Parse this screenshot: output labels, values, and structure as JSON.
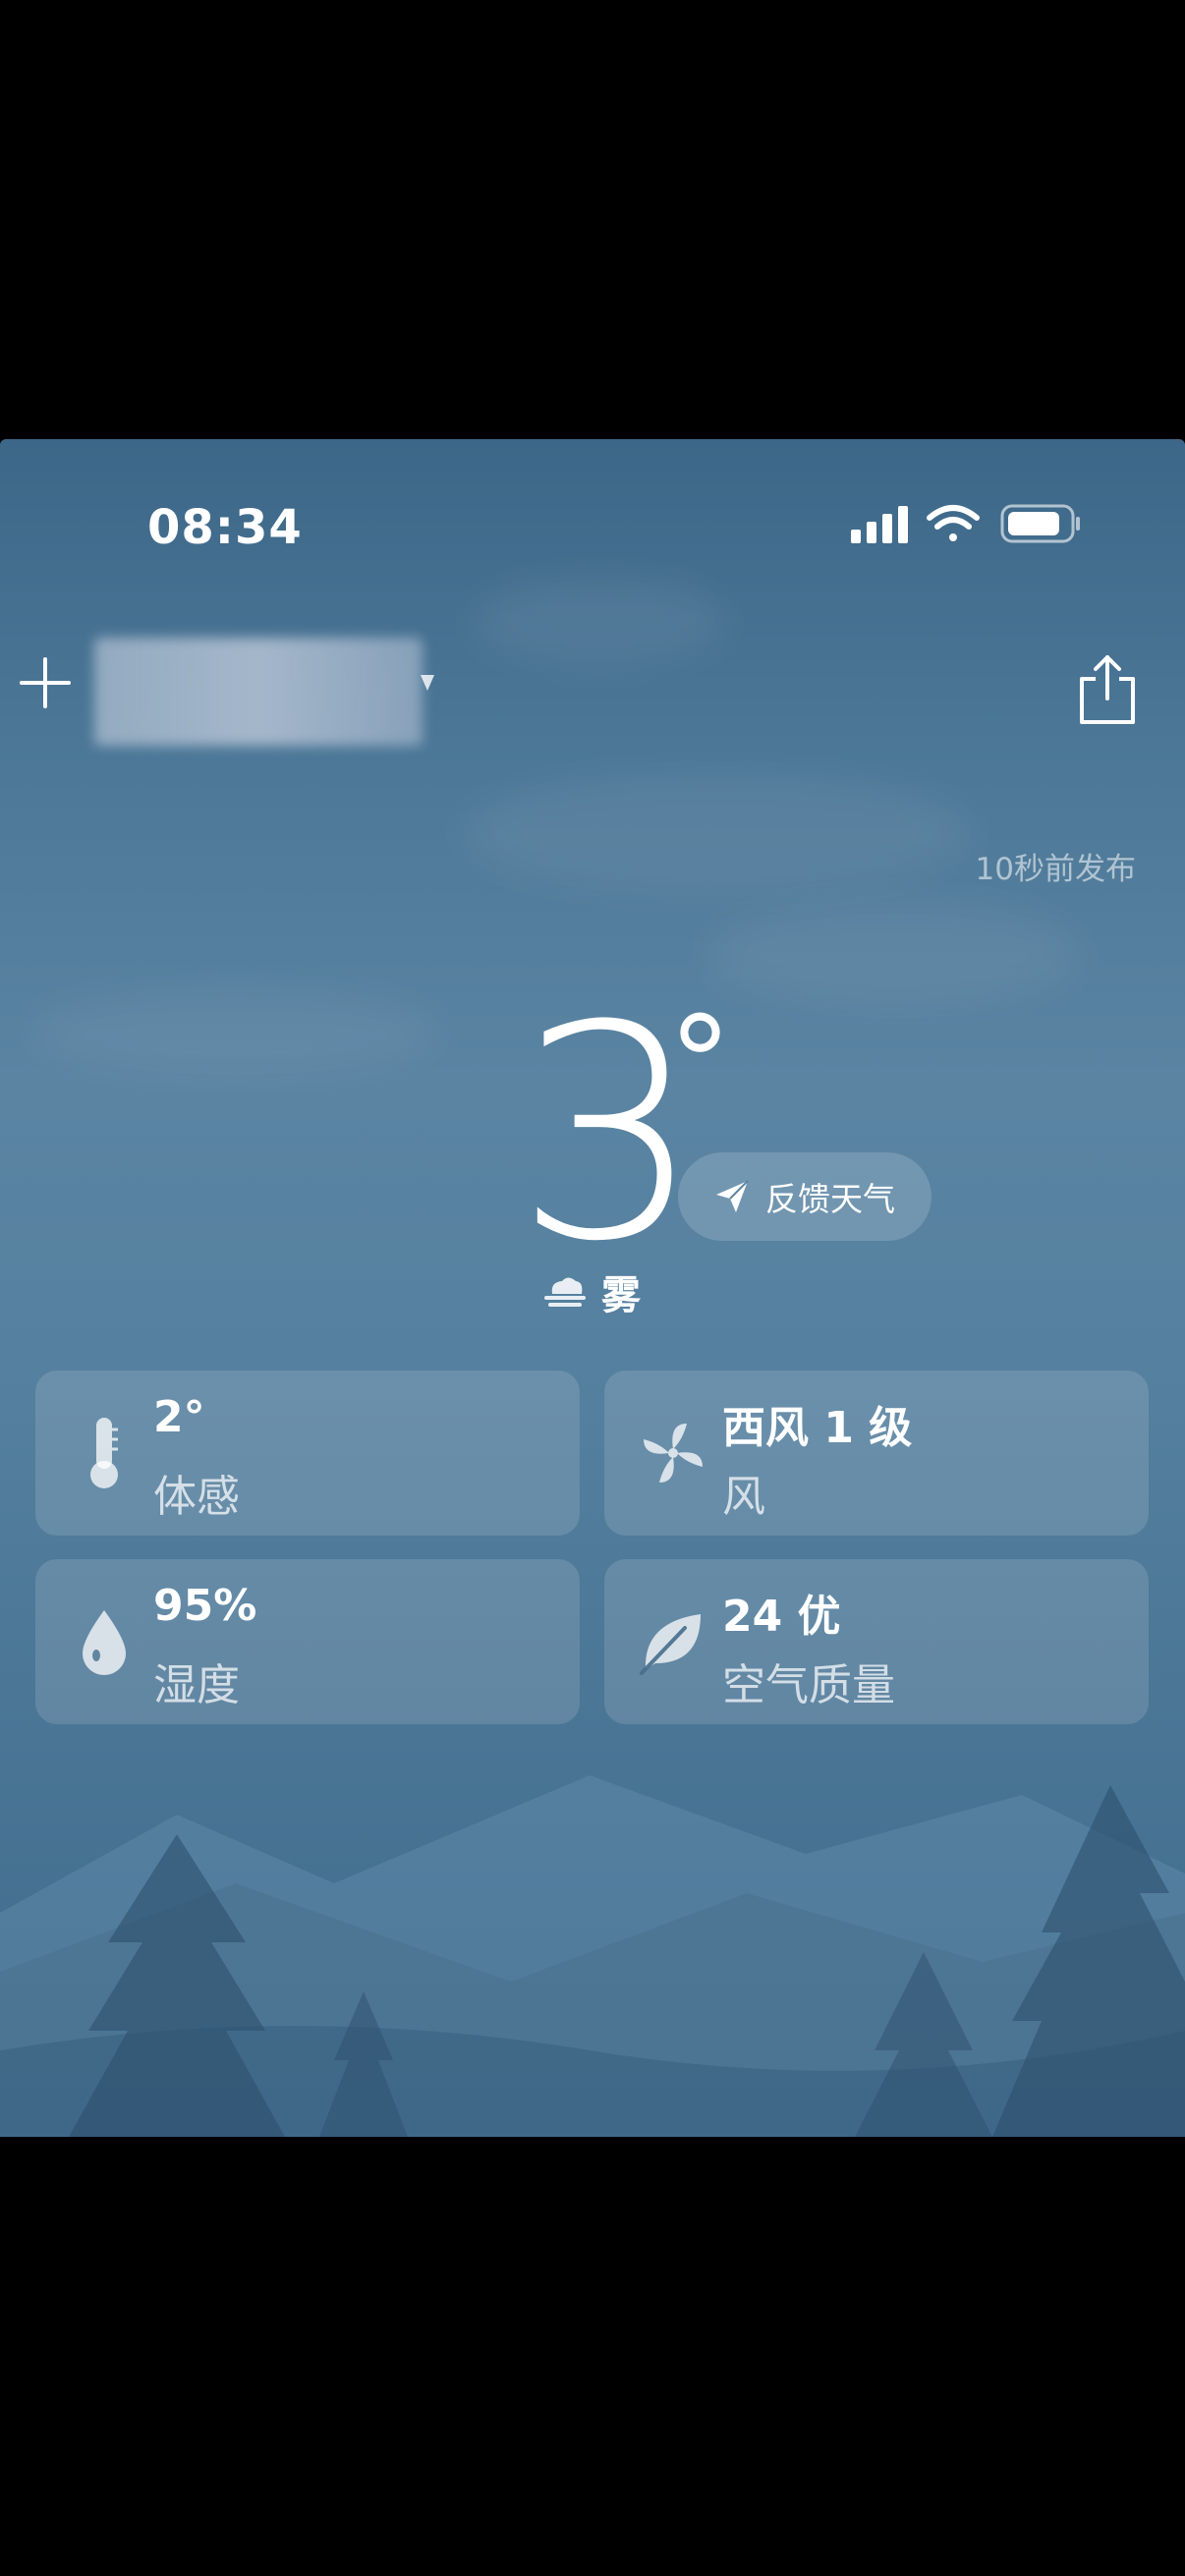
{
  "status_bar": {
    "time": "08:34",
    "icons": [
      "signal-icon",
      "wifi-icon",
      "battery-icon"
    ]
  },
  "header": {
    "add_icon": "plus-icon",
    "share_icon": "share-icon",
    "published": "10秒前发布"
  },
  "current": {
    "temperature": "3",
    "degree_symbol": "°",
    "condition": "雾",
    "condition_icon": "fog-icon",
    "feedback_label": "反馈天气",
    "feedback_icon": "paper-plane-icon"
  },
  "cards": [
    {
      "value": "2°",
      "label": "体感",
      "icon": "thermometer-icon"
    },
    {
      "value": "西风 1 级",
      "label": "风",
      "icon": "fan-icon"
    },
    {
      "value": "95%",
      "label": "湿度",
      "icon": "water-drop-icon"
    },
    {
      "value": "24 优",
      "label": "空气质量",
      "icon": "leaf-icon"
    }
  ],
  "colors": {
    "background_top": "#3d6788",
    "background_mid": "#5a84a2",
    "text": "#ffffff"
  }
}
